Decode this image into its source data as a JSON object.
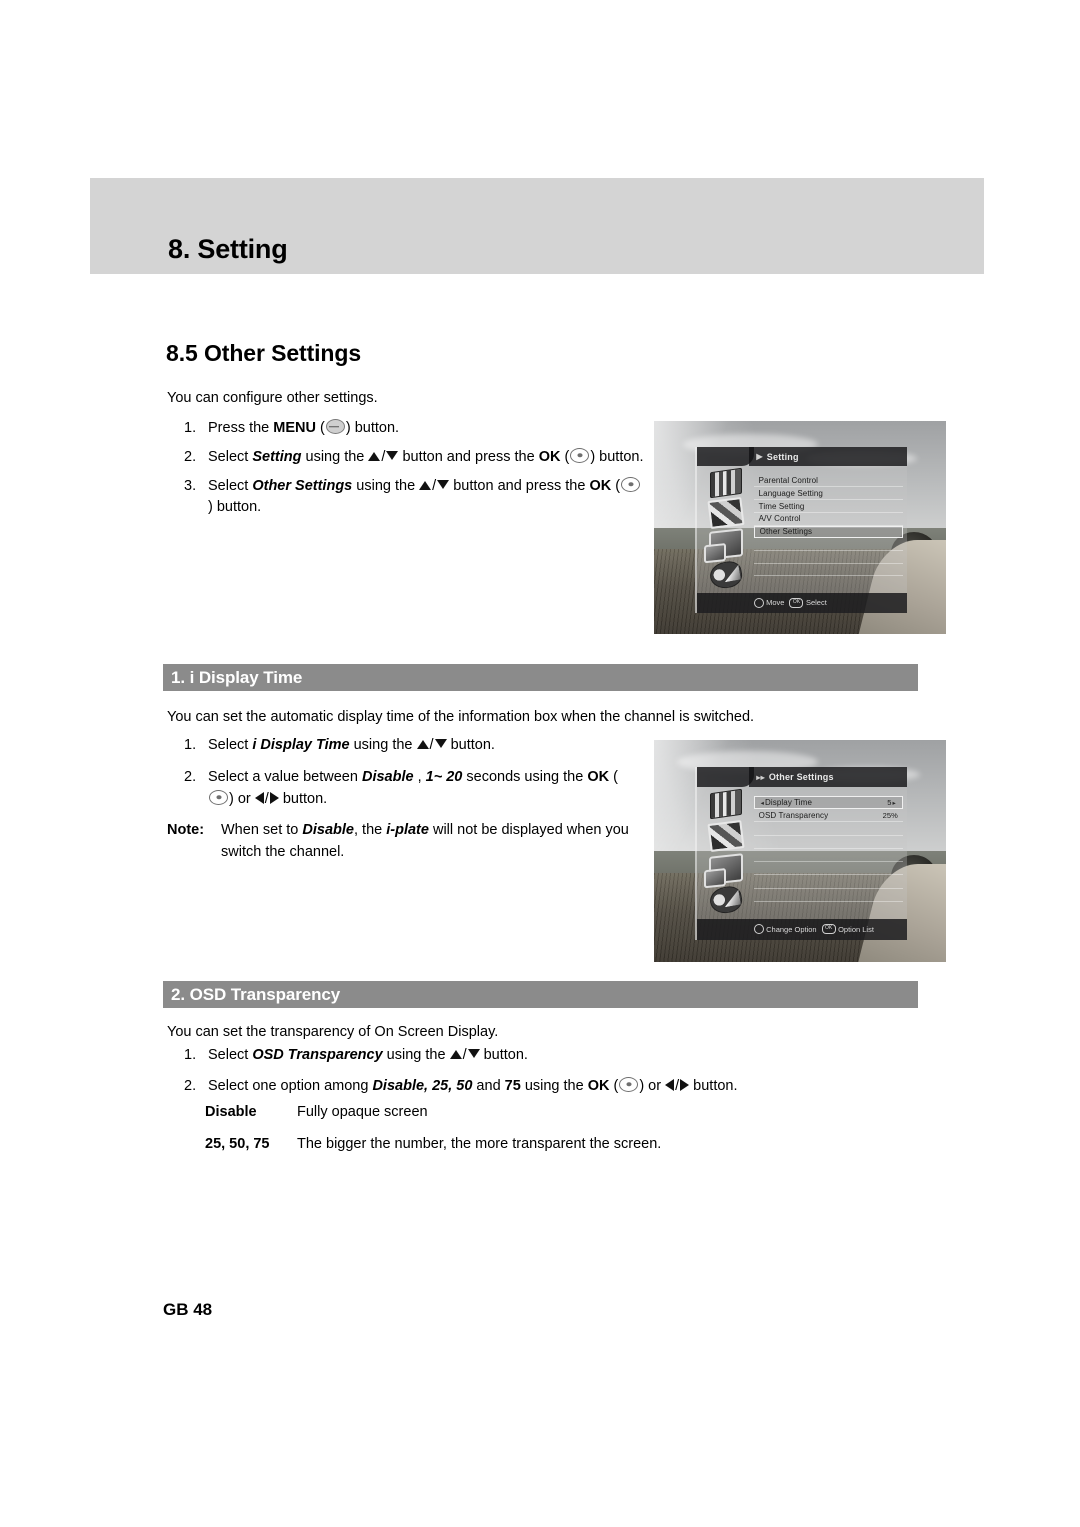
{
  "chapter": {
    "title": "8. Setting"
  },
  "section": {
    "title": "8.5 Other Settings",
    "intro": "You can configure other settings.",
    "steps": [
      {
        "num": "1.",
        "pre": "Press the ",
        "bold1": "MENU",
        "mid": " (",
        "post": ") button."
      },
      {
        "num": "2.",
        "pre": "Select ",
        "bolditalic": "Setting",
        "mid": " using the ",
        "mid2": " button and press the ",
        "bold2": "OK",
        "post": " (",
        "tail": ") button."
      },
      {
        "num": "3.",
        "pre": "Select ",
        "bolditalic": "Other Settings",
        "mid": " using the ",
        "mid2": " button and press the ",
        "bold2": "OK",
        "post": " (",
        "tail": ") button."
      }
    ]
  },
  "sub1": {
    "bar_label": "1. i Display Time",
    "intro": "You can set the automatic display time of the information box when the channel is switched.",
    "step1": {
      "num": "1.",
      "pre": "Select ",
      "bolditalic": "i Display Time",
      "mid": " using the ",
      "post": " button."
    },
    "step2": {
      "num": "2.",
      "pre": "Select a value between ",
      "bi1": "Disable",
      "mid1": " , ",
      "bi2": "1~ 20",
      "mid2": " seconds using the ",
      "bold_ok": "OK",
      "mid3": " (",
      "mid4": ") or ",
      "post": " button."
    },
    "note": {
      "label": "Note:",
      "pre": "When set to ",
      "bi1": "Disable",
      "mid1": ", the ",
      "bi2": "i-plate",
      "post": " will not be displayed when you switch the channel."
    }
  },
  "sub2": {
    "bar_label": "2. OSD Transparency",
    "intro": "You can set the transparency of On Screen Display.",
    "step1": {
      "num": "1.",
      "pre": "Select ",
      "bolditalic": "OSD Transparency",
      "mid": " using the ",
      "post": " button."
    },
    "step2": {
      "num": "2.",
      "pre": "Select one option among ",
      "bi1": "Disable, 25, 50",
      "mid1": " and ",
      "bi2": "75",
      "mid2": " using the ",
      "bold_ok": "OK",
      "mid3": " (",
      "mid4": ") or ",
      "post": " button."
    },
    "definitions": [
      {
        "key": "Disable",
        "value": "Fully opaque screen"
      },
      {
        "key": "25, 50, 75",
        "value": "The bigger the number, the more transparent the screen."
      }
    ]
  },
  "osd_setting": {
    "title": "Setting",
    "items": [
      {
        "label": "Parental Control",
        "value": "",
        "selected": false
      },
      {
        "label": "Language Setting",
        "value": "",
        "selected": false
      },
      {
        "label": "Time Setting",
        "value": "",
        "selected": false
      },
      {
        "label": "A/V Control",
        "value": "",
        "selected": false
      },
      {
        "label": "Other Settings",
        "value": "",
        "selected": true
      }
    ],
    "hints": [
      {
        "key": "circle",
        "label": "Move"
      },
      {
        "key": "ok",
        "label": "Select"
      }
    ],
    "icons": [
      "equalizer-icon",
      "picture-icon",
      "display-icon",
      "tools-icon"
    ]
  },
  "osd_other_settings": {
    "title": "Other Settings",
    "items": [
      {
        "label": "Display Time",
        "value": "5",
        "selected": true,
        "arrows": true
      },
      {
        "label": "OSD Transparency",
        "value": "25%",
        "selected": false,
        "arrows": false
      }
    ],
    "hints": [
      {
        "key": "circle",
        "label": "Change Option"
      },
      {
        "key": "ok",
        "label": "Option List"
      }
    ],
    "icons": [
      "equalizer-icon",
      "picture-icon",
      "display-icon",
      "tools-icon"
    ]
  },
  "footer": {
    "page": "GB 48"
  },
  "colors": {
    "chapter_band": "#d4d4d4",
    "subsection_bar": "#8b8b8b",
    "text": "#000000"
  }
}
